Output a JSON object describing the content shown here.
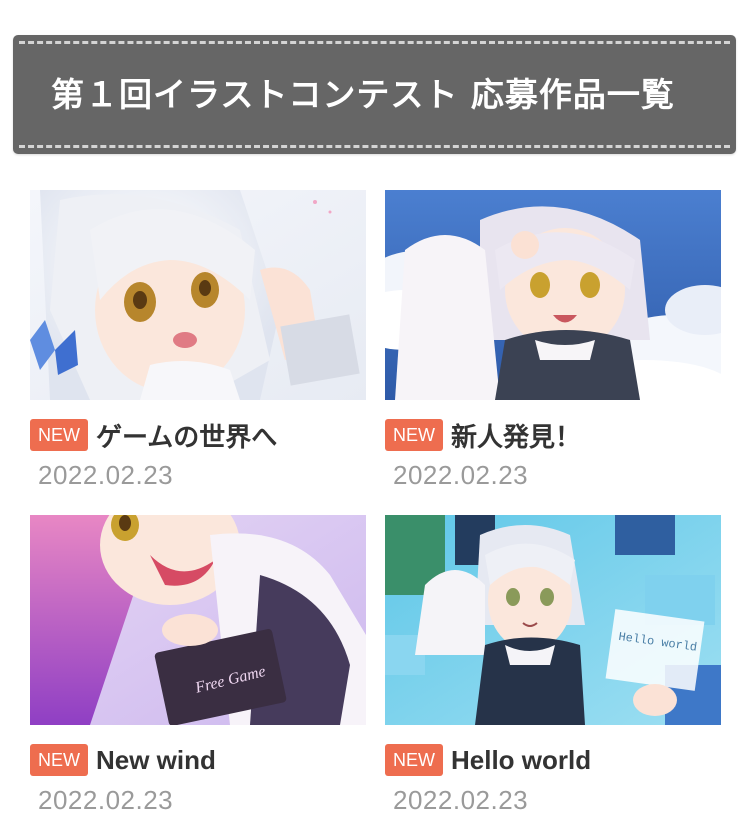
{
  "banner": {
    "title": "第１回イラストコンテスト 応募作品一覧"
  },
  "entries": [
    {
      "badge": "NEW",
      "title": "ゲームの世界へ",
      "date": "2022.02.23"
    },
    {
      "badge": "NEW",
      "title": "新人発見！",
      "date": "2022.02.23"
    },
    {
      "badge": "NEW",
      "title": "New wind",
      "date": "2022.02.23"
    },
    {
      "badge": "NEW",
      "title": "Hello world",
      "date": "2022.02.23"
    }
  ],
  "artwork_text": {
    "free_game": "Free Game",
    "hello_world": "Hello world"
  },
  "colors": {
    "banner_bg": "#666666",
    "badge_bg": "#ee6d4f",
    "date_text": "#9a9a9a"
  }
}
